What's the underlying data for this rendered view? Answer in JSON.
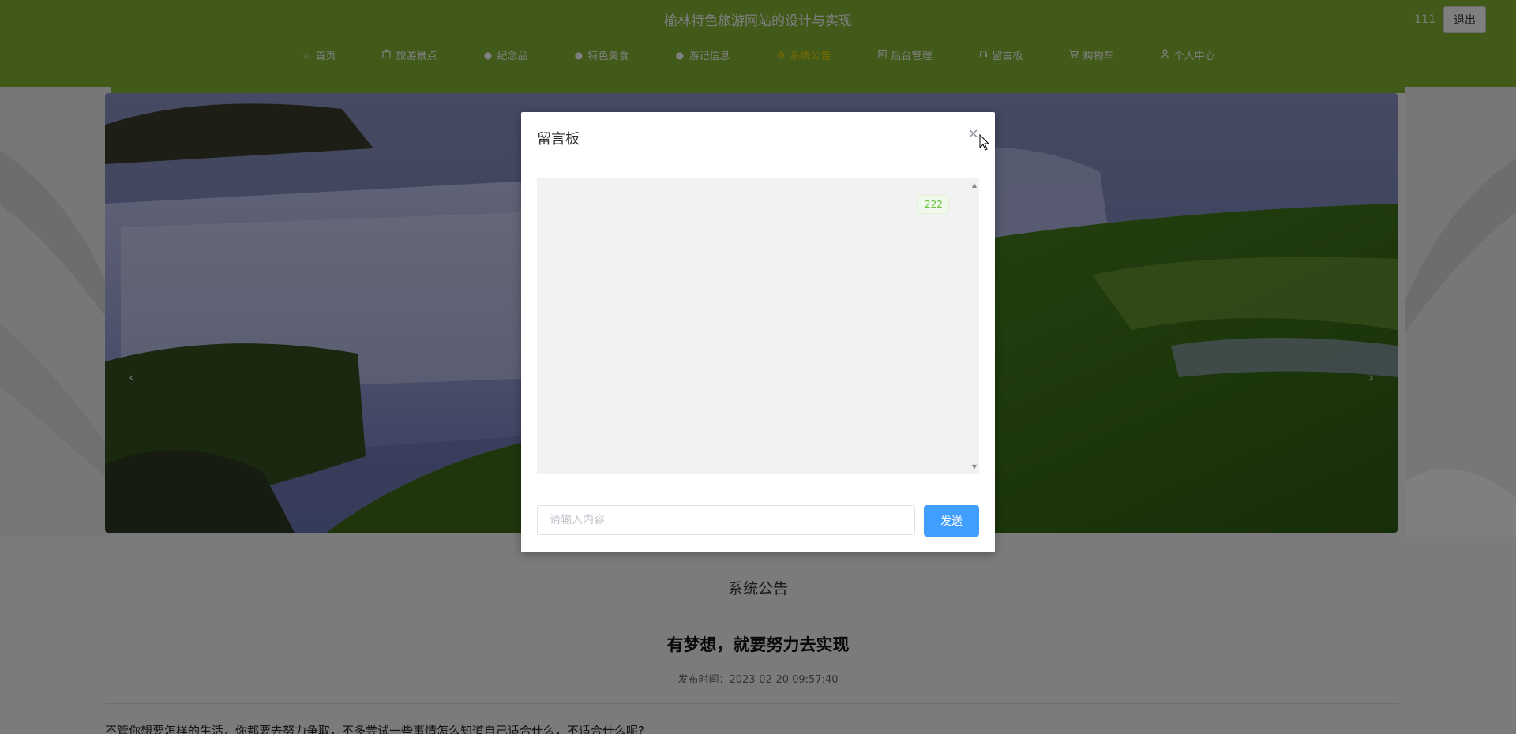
{
  "header": {
    "site_title": "榆林特色旅游网站的设计与实现",
    "username": "111",
    "logout_label": "退出",
    "nav": [
      {
        "label": "首页",
        "icon": "star-icon"
      },
      {
        "label": "旅游景点",
        "icon": "bag-icon"
      },
      {
        "label": "纪念品",
        "icon": "dot-icon"
      },
      {
        "label": "特色美食",
        "icon": "dot-icon"
      },
      {
        "label": "游记信息",
        "icon": "dot-icon"
      },
      {
        "label": "系统公告",
        "icon": "gear-icon",
        "active": true
      },
      {
        "label": "后台管理",
        "icon": "clipboard-icon"
      },
      {
        "label": "留言板",
        "icon": "headset-icon"
      },
      {
        "label": "购物车",
        "icon": "cart-icon"
      },
      {
        "label": "个人中心",
        "icon": "user-icon"
      }
    ]
  },
  "notice": {
    "section_title": "系统公告",
    "title": "有梦想，就要努力去实现",
    "publish_time": "发布时间：2023-02-20 09:57:40",
    "body": "不管你想要怎样的生活，你都要去努力争取，不多尝试一些事情怎么知道自己适合什么，不适合什么呢?"
  },
  "dialog": {
    "title": "留言板",
    "close_icon": "close-icon",
    "messages": [
      {
        "text": "222"
      }
    ],
    "input_placeholder": "请输入内容",
    "input_value": "",
    "send_label": "发送"
  },
  "colors": {
    "header_green": "#82b435",
    "active_nav": "#f5d400",
    "send_button": "#409eff",
    "message_badge_text": "#67c23a"
  }
}
